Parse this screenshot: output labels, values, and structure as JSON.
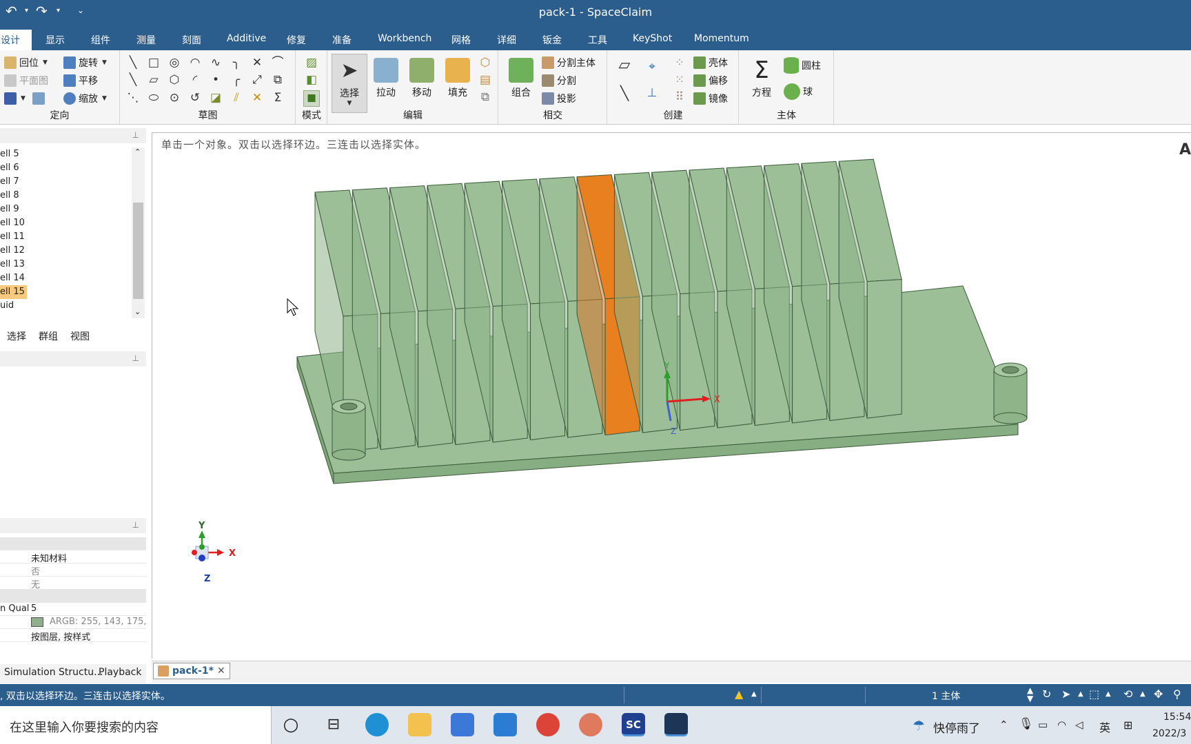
{
  "window": {
    "title": "pack-1 - SpaceClaim"
  },
  "ribbon_tabs": [
    "设计",
    "显示",
    "组件",
    "测量",
    "刻面",
    "Additive",
    "修复",
    "准备",
    "Workbench",
    "网格",
    "详细",
    "钣金",
    "工具",
    "KeyShot",
    "Momentum"
  ],
  "ribbon": {
    "orient": {
      "label": "定向",
      "items": [
        "回位",
        "旋转",
        "平面图",
        "平移",
        "缩放"
      ]
    },
    "sketch": {
      "label": "草图"
    },
    "mode": {
      "label": "模式"
    },
    "edit": {
      "label": "编辑",
      "select": "选择",
      "pull": "拉动",
      "move": "移动",
      "fill": "填充"
    },
    "intersect": {
      "label": "相交",
      "combine": "组合",
      "split_body": "分割主体",
      "split": "分割",
      "project": "投影"
    },
    "create": {
      "label": "创建",
      "shell": "壳体",
      "offset": "偏移",
      "mirror": "镜像"
    },
    "body": {
      "label": "主体",
      "equation": "方程",
      "cylinder": "圆柱",
      "sphere": "球"
    }
  },
  "structure_tree": {
    "items": [
      "ell 5",
      "ell 6",
      "ell 7",
      "ell 8",
      "ell 9",
      "ell 10",
      "ell 11",
      "ell 12",
      "ell 13",
      "ell 14",
      "ell 15",
      "uid"
    ],
    "selected": "ell 15"
  },
  "panel_tabs": [
    "选择",
    "群组",
    "视图"
  ],
  "properties": {
    "material": "未知材料",
    "row2": "否",
    "row3": "无",
    "mesh_key": "n Qual",
    "mesh_val": "5",
    "color": "ARGB: 255, 143, 175,",
    "color_hex": "#8faf8c",
    "style": "按图层, 按样式"
  },
  "viewport": {
    "hint": "单击一个对象。双击以选择环边。三连击以选择实体。",
    "corner_letter": "A",
    "axes": {
      "x": "X",
      "y": "Y",
      "z": "Z"
    }
  },
  "bottom_panel_tabs": [
    "Simulation Structu...",
    "Playback"
  ],
  "doc_tab": {
    "label": "pack-1*"
  },
  "status": {
    "hint": ", 双击以选择环边。三连击以选择实体。",
    "bodies": "1 主体"
  },
  "taskbar": {
    "search_placeholder": "在这里输入你要搜索的内容",
    "weather": "快停雨了",
    "ime": "英",
    "time": "15:54",
    "date": "2022/3"
  },
  "colors": {
    "chrome": "#2b5d8d",
    "body": "#9cbf98",
    "selected": "#e9801f"
  }
}
